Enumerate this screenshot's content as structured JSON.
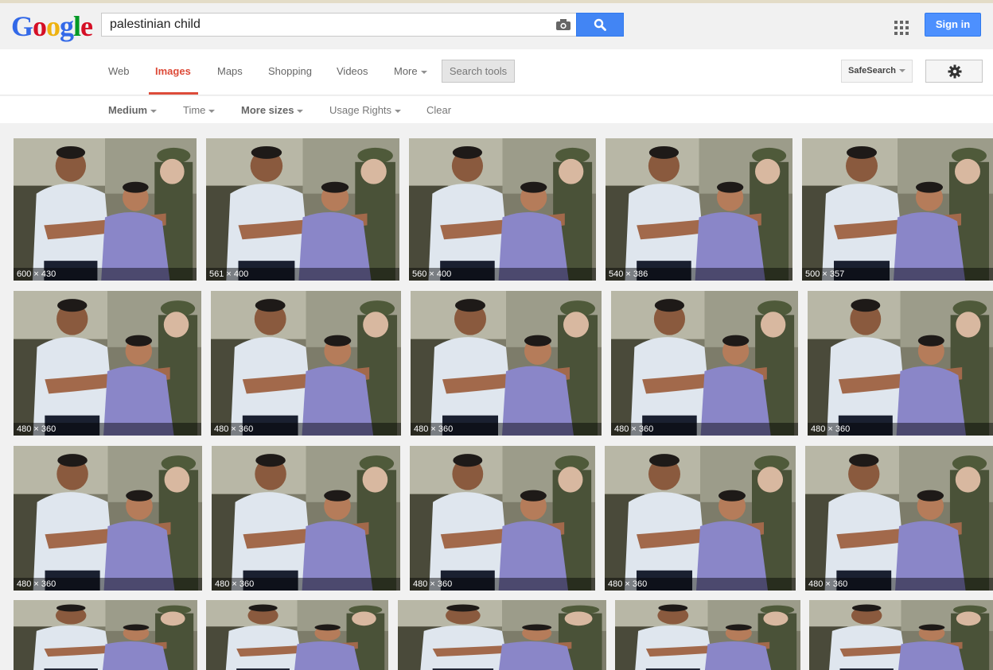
{
  "logo": {
    "letters": [
      "G",
      "o",
      "o",
      "g",
      "l",
      "e"
    ],
    "colors": [
      "#3369e8",
      "#d50f25",
      "#eeb211",
      "#3369e8",
      "#009925",
      "#d50f25"
    ]
  },
  "search": {
    "query": "palestinian child"
  },
  "header": {
    "signin_label": "Sign in"
  },
  "tabs": [
    {
      "label": "Web"
    },
    {
      "label": "Images",
      "active": true
    },
    {
      "label": "Maps"
    },
    {
      "label": "Shopping"
    },
    {
      "label": "Videos"
    },
    {
      "label": "More"
    }
  ],
  "search_tools_label": "Search tools",
  "safesearch_label": "SafeSearch",
  "filters": [
    {
      "label": "Medium"
    },
    {
      "label": "Time"
    },
    {
      "label": "More sizes"
    },
    {
      "label": "Usage Rights"
    },
    {
      "label": "Clear"
    }
  ],
  "results": [
    [
      "600 × 430",
      "561 × 400",
      "560 × 400",
      "540 × 386",
      "500 × 357"
    ],
    [
      "480 × 360",
      "480 × 360",
      "480 × 360",
      "480 × 360",
      "480 × 360"
    ],
    [
      "480 × 360",
      "480 × 360",
      "480 × 360",
      "480 × 360",
      "480 × 360"
    ],
    [
      "",
      "",
      "",
      "",
      ""
    ]
  ],
  "colors": {
    "accent": "#dd4b39",
    "button_blue": "#4285f4",
    "signin_blue": "#4d90fe"
  }
}
